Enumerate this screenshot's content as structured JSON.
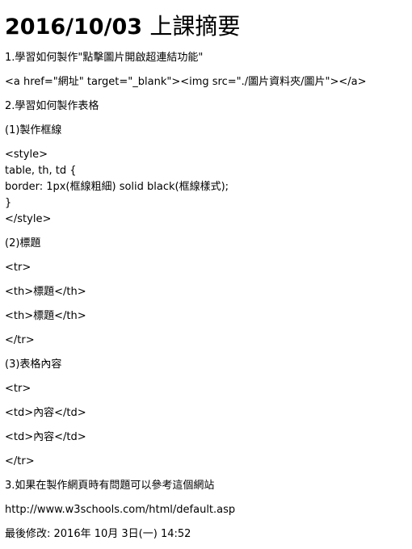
{
  "heading": {
    "date": "2016/10/03",
    "title": "上課摘要"
  },
  "lines": [
    "1.學習如何製作\"點擊圖片開啟超連結功能\"",
    "<a href=\"網址\" target=\"_blank\"><img src=\"./圖片資料夾/圖片\"></a>",
    "2.學習如何製作表格",
    "(1)製作框線",
    "<style>",
    "table, th, td {",
    "border: 1px(框線粗細) solid black(框線樣式);",
    "}",
    "</style>",
    "(2)標題",
    "<tr>",
    "<th>標題</th>",
    "<th>標題</th>",
    "</tr>",
    "(3)表格內容",
    "<tr>",
    "<td>內容</td>",
    "<td>內容</td>",
    "</tr>",
    "3.如果在製作網頁時有問題可以參考這個網站",
    "http://www.w3schools.com/html/default.asp",
    "最後修改: 2016年 10月 3日(一) 14:52"
  ]
}
